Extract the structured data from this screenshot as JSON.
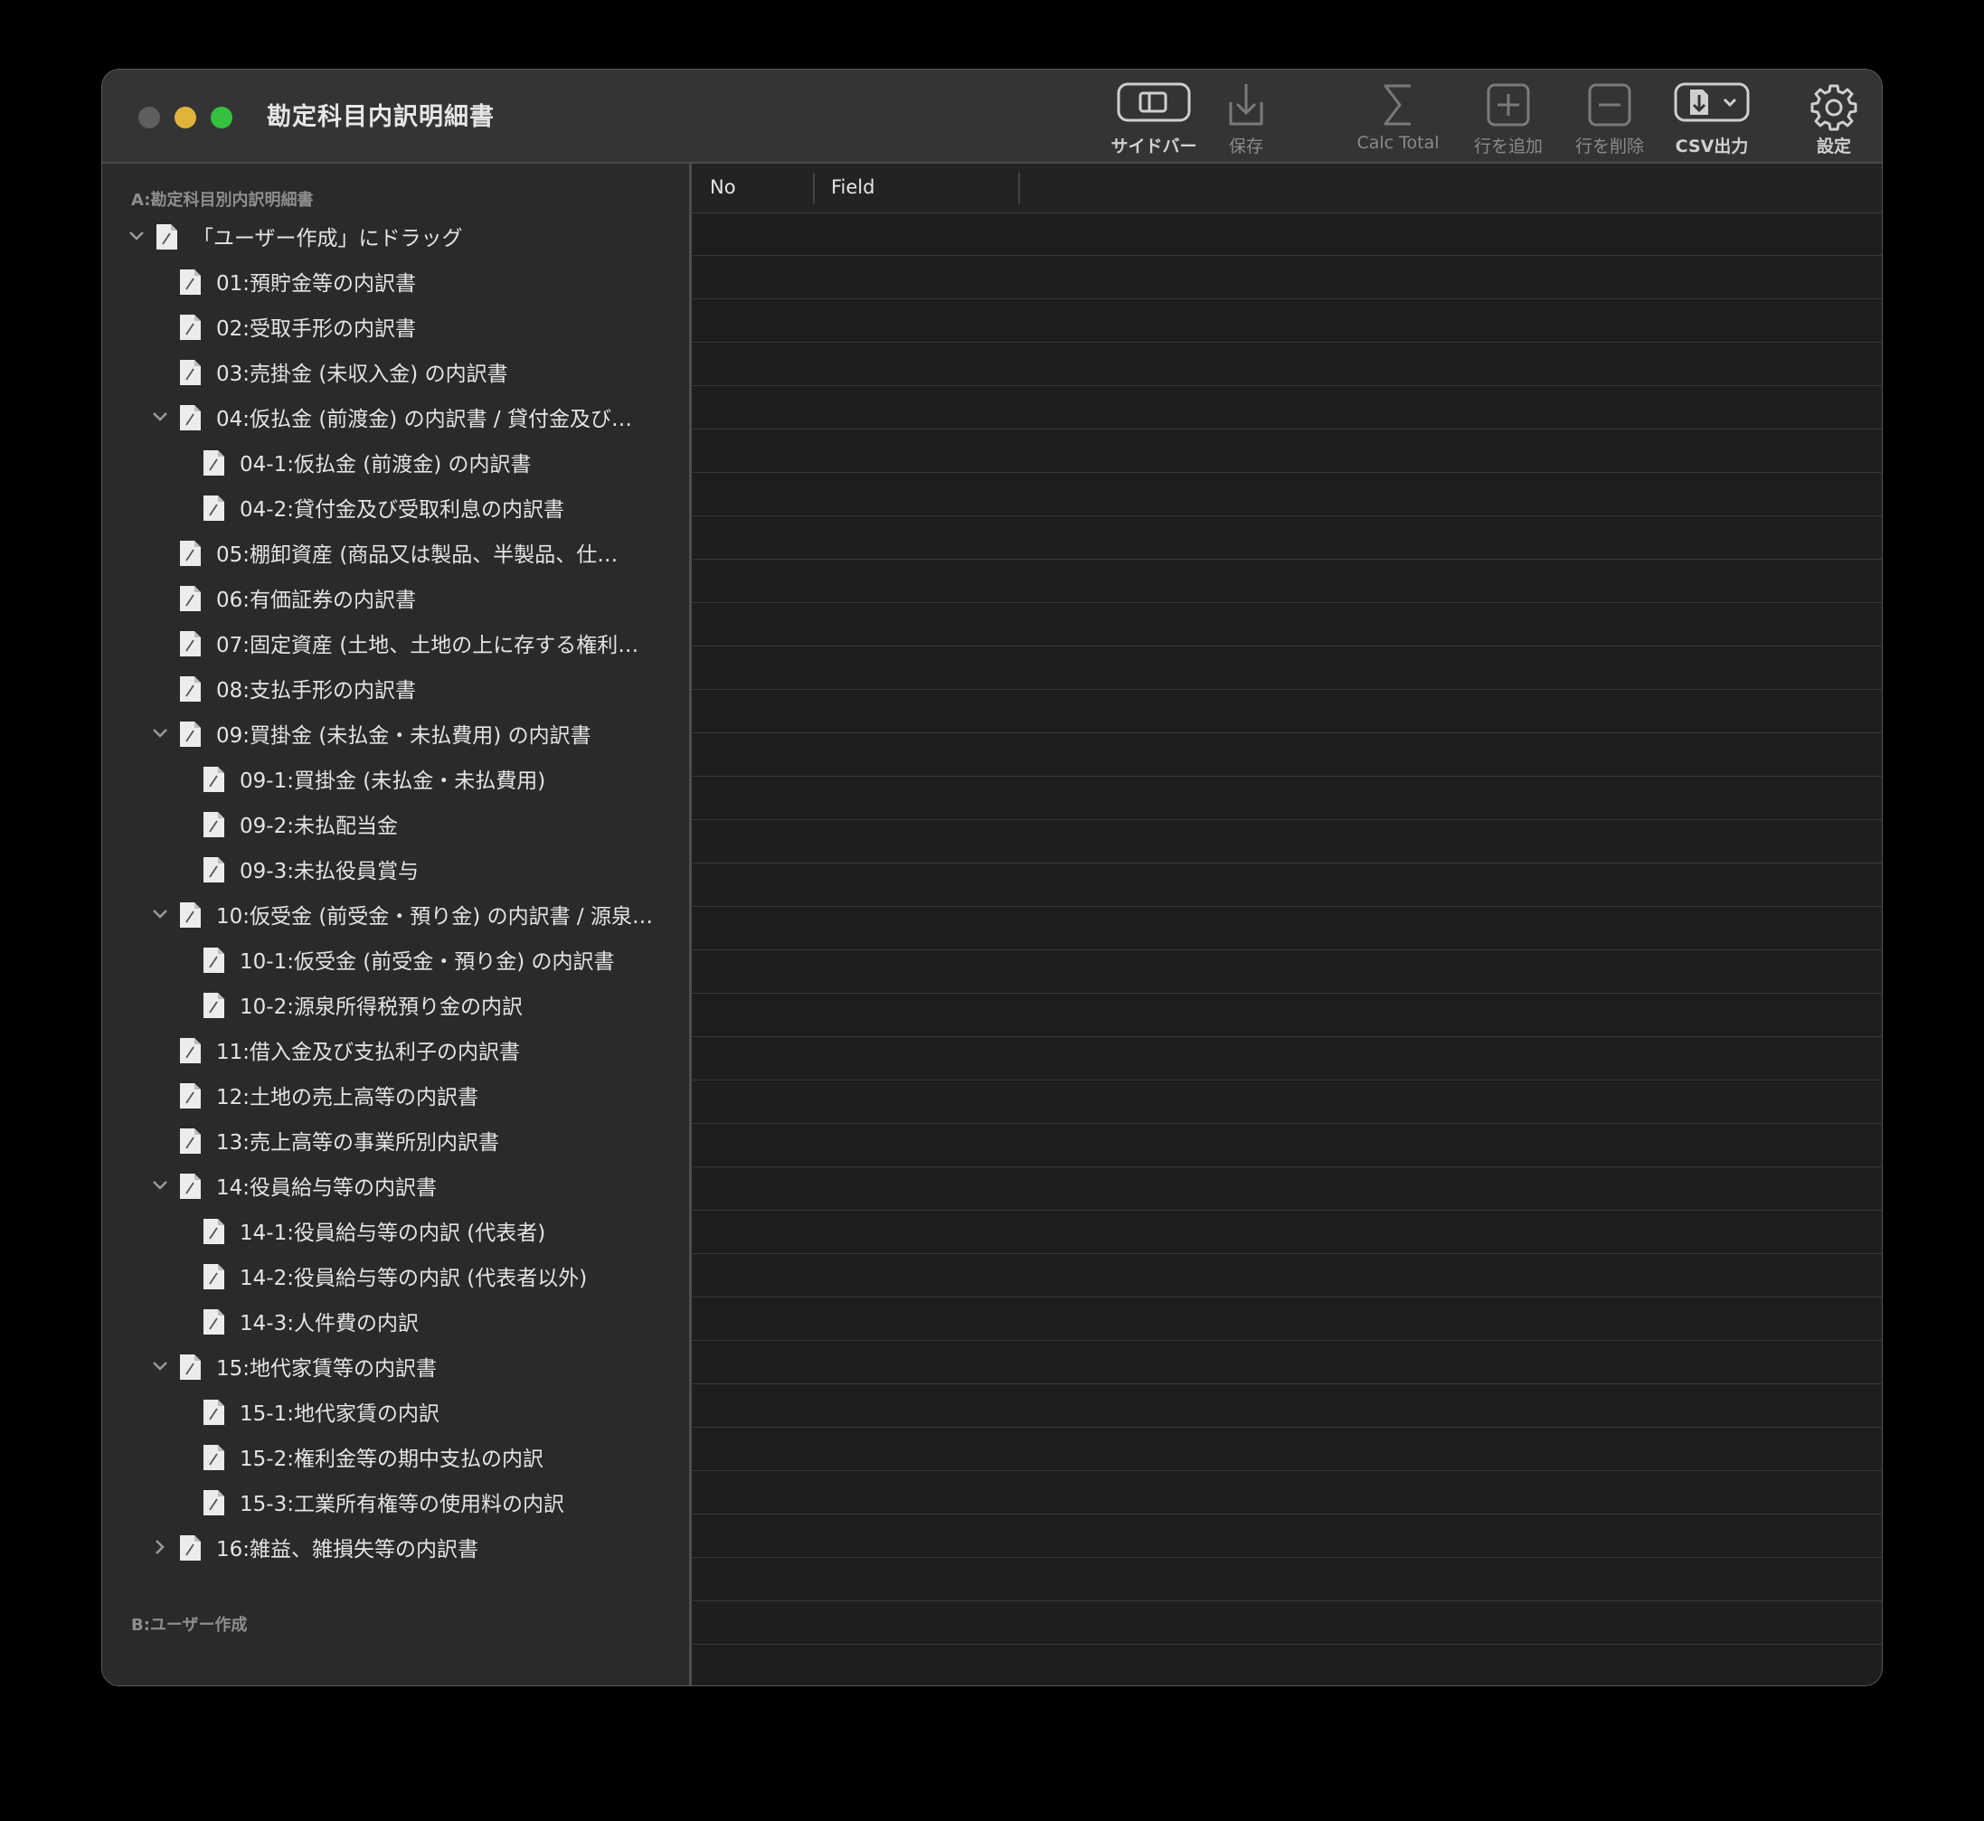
{
  "window": {
    "title": "勘定科目内訳明細書"
  },
  "toolbar": {
    "sidebar_label": "サイドバー",
    "save_label": "保存",
    "calc_total_label": "Calc Total",
    "add_row_label": "行を追加",
    "delete_row_label": "行を削除",
    "csv_export_label": "CSV出力",
    "settings_label": "設定"
  },
  "sidebar": {
    "section_a": "A:勘定科目別内訳明細書",
    "section_b": "B:ユーザー作成",
    "items": [
      {
        "label": "「ユーザー作成」にドラッグ",
        "level": 0,
        "disclosure": "expanded"
      },
      {
        "label": "01:預貯金等の内訳書",
        "level": 1,
        "disclosure": "none"
      },
      {
        "label": "02:受取手形の内訳書",
        "level": 1,
        "disclosure": "none"
      },
      {
        "label": "03:売掛金 (未収入金) の内訳書",
        "level": 1,
        "disclosure": "none"
      },
      {
        "label": "04:仮払金 (前渡金) の内訳書 / 貸付金及び…",
        "level": 1,
        "disclosure": "expanded"
      },
      {
        "label": "04-1:仮払金 (前渡金) の内訳書",
        "level": 2,
        "disclosure": "none"
      },
      {
        "label": "04-2:貸付金及び受取利息の内訳書",
        "level": 2,
        "disclosure": "none"
      },
      {
        "label": "05:棚卸資産 (商品又は製品、半製品、仕…",
        "level": 1,
        "disclosure": "none"
      },
      {
        "label": "06:有価証券の内訳書",
        "level": 1,
        "disclosure": "none"
      },
      {
        "label": "07:固定資産 (土地、土地の上に存する権利…",
        "level": 1,
        "disclosure": "none"
      },
      {
        "label": "08:支払手形の内訳書",
        "level": 1,
        "disclosure": "none"
      },
      {
        "label": "09:買掛金 (未払金・未払費用) の内訳書",
        "level": 1,
        "disclosure": "expanded"
      },
      {
        "label": "09-1:買掛金 (未払金・未払費用)",
        "level": 2,
        "disclosure": "none"
      },
      {
        "label": "09-2:未払配当金",
        "level": 2,
        "disclosure": "none"
      },
      {
        "label": "09-3:未払役員賞与",
        "level": 2,
        "disclosure": "none"
      },
      {
        "label": "10:仮受金 (前受金・預り金) の内訳書 / 源泉…",
        "level": 1,
        "disclosure": "expanded"
      },
      {
        "label": "10-1:仮受金 (前受金・預り金) の内訳書",
        "level": 2,
        "disclosure": "none"
      },
      {
        "label": "10-2:源泉所得税預り金の内訳",
        "level": 2,
        "disclosure": "none"
      },
      {
        "label": "11:借入金及び支払利子の内訳書",
        "level": 1,
        "disclosure": "none"
      },
      {
        "label": "12:土地の売上高等の内訳書",
        "level": 1,
        "disclosure": "none"
      },
      {
        "label": "13:売上高等の事業所別内訳書",
        "level": 1,
        "disclosure": "none"
      },
      {
        "label": "14:役員給与等の内訳書",
        "level": 1,
        "disclosure": "expanded"
      },
      {
        "label": "14-1:役員給与等の内訳 (代表者)",
        "level": 2,
        "disclosure": "none"
      },
      {
        "label": "14-2:役員給与等の内訳 (代表者以外)",
        "level": 2,
        "disclosure": "none"
      },
      {
        "label": "14-3:人件費の内訳",
        "level": 2,
        "disclosure": "none"
      },
      {
        "label": "15:地代家賃等の内訳書",
        "level": 1,
        "disclosure": "expanded"
      },
      {
        "label": "15-1:地代家賃の内訳",
        "level": 2,
        "disclosure": "none"
      },
      {
        "label": "15-2:権利金等の期中支払の内訳",
        "level": 2,
        "disclosure": "none"
      },
      {
        "label": "15-3:工業所有権等の使用料の内訳",
        "level": 2,
        "disclosure": "none"
      },
      {
        "label": "16:雑益、雑損失等の内訳書",
        "level": 1,
        "disclosure": "collapsed"
      }
    ]
  },
  "table": {
    "columns": [
      "No",
      "Field"
    ],
    "rows": []
  },
  "icons": {
    "sidebar": "sidebar-toggle-icon",
    "save": "download-icon",
    "calc_total": "sigma-icon",
    "add_row": "plus-square-icon",
    "delete_row": "minus-square-icon",
    "csv_export": "document-export-icon",
    "settings": "gear-icon",
    "tree_item": "document-icon"
  },
  "colors": {
    "close": "#5e5e5e",
    "minimize": "#e0b43a",
    "zoom": "#35c13f"
  }
}
